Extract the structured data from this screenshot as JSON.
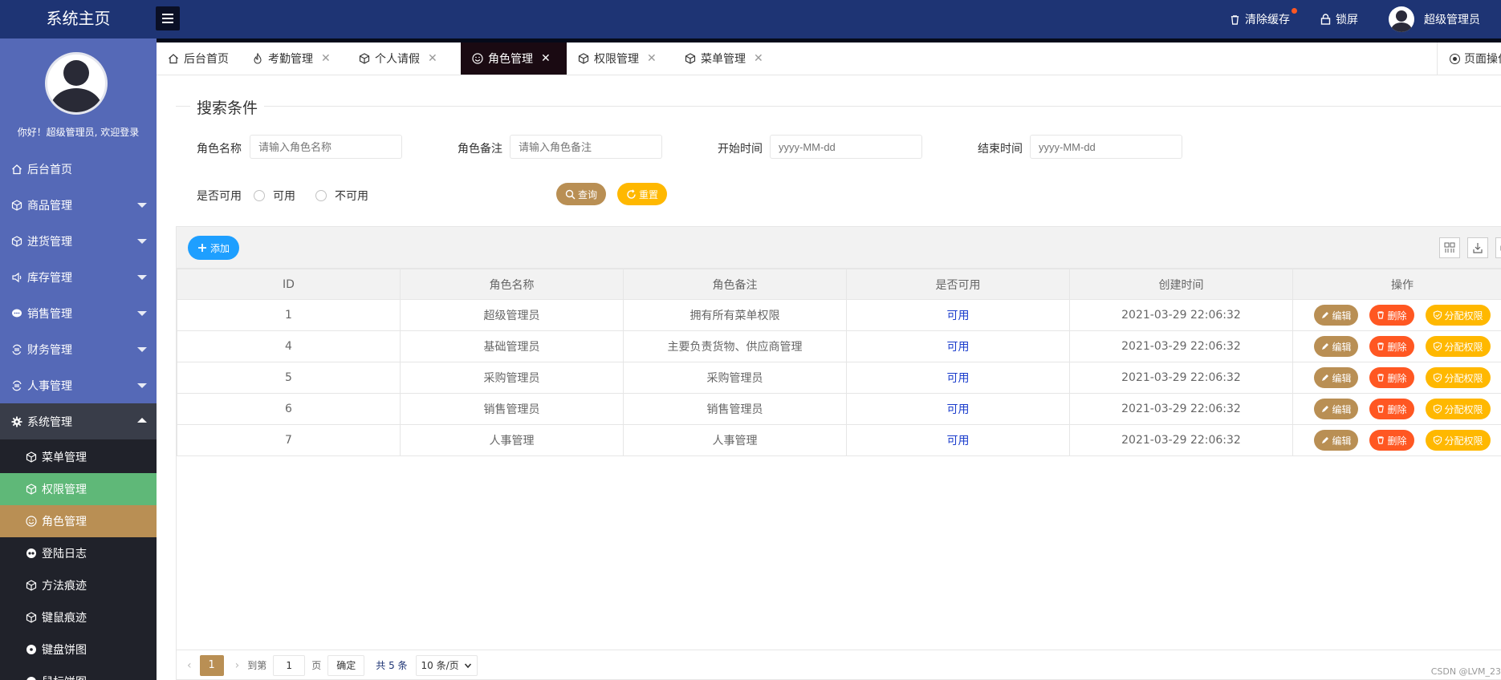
{
  "header": {
    "brand": "系统主页",
    "clear_cache": "清除缓存",
    "lock_screen": "锁屏",
    "username": "超级管理员"
  },
  "sidebar": {
    "welcome": "你好！超级管理员, 欢迎登录",
    "items": [
      {
        "label": "后台首页",
        "icon": "home-icon"
      },
      {
        "label": "商品管理",
        "icon": "cube-icon"
      },
      {
        "label": "进货管理",
        "icon": "cube-icon"
      },
      {
        "label": "库存管理",
        "icon": "speaker-icon"
      },
      {
        "label": "销售管理",
        "icon": "chat-icon"
      },
      {
        "label": "财务管理",
        "icon": "exchange-icon"
      },
      {
        "label": "人事管理",
        "icon": "exchange-icon"
      },
      {
        "label": "系统管理",
        "icon": "gear-icon"
      }
    ],
    "sub_items": [
      {
        "label": "菜单管理",
        "icon": "cube-icon"
      },
      {
        "label": "权限管理",
        "icon": "cube-icon"
      },
      {
        "label": "角色管理",
        "icon": "smile-icon"
      },
      {
        "label": "登陆日志",
        "icon": "eye-icon"
      },
      {
        "label": "方法痕迹",
        "icon": "cube-icon"
      },
      {
        "label": "键鼠痕迹",
        "icon": "cube-icon"
      },
      {
        "label": "键盘饼图",
        "icon": "disc-icon"
      },
      {
        "label": "鼠标饼图",
        "icon": "disc-icon"
      }
    ]
  },
  "tabs": [
    {
      "label": "后台首页"
    },
    {
      "label": "考勤管理"
    },
    {
      "label": "个人请假"
    },
    {
      "label": "角色管理"
    },
    {
      "label": "权限管理"
    },
    {
      "label": "菜单管理"
    }
  ],
  "tab_close": "✕",
  "page_ops": "页面操作",
  "search": {
    "legend": "搜索条件",
    "role_name_label": "角色名称",
    "role_name_placeholder": "请输入角色名称",
    "role_remark_label": "角色备注",
    "role_remark_placeholder": "请输入角色备注",
    "start_label": "开始时间",
    "start_placeholder": "yyyy-MM-dd",
    "end_label": "结束时间",
    "end_placeholder": "yyyy-MM-dd",
    "available_label": "是否可用",
    "opt_yes": "可用",
    "opt_no": "不可用",
    "query": "查询",
    "reset": "重置"
  },
  "toolbar": {
    "add": "添加"
  },
  "table": {
    "headers": [
      "ID",
      "角色名称",
      "角色备注",
      "是否可用",
      "创建时间",
      "操作"
    ],
    "rows": [
      {
        "id": "1",
        "name": "超级管理员",
        "remark": "拥有所有菜单权限",
        "available": "可用",
        "created": "2021-03-29 22:06:32"
      },
      {
        "id": "4",
        "name": "基础管理员",
        "remark": "主要负责货物、供应商管理",
        "available": "可用",
        "created": "2021-03-29 22:06:32"
      },
      {
        "id": "5",
        "name": "采购管理员",
        "remark": "采购管理员",
        "available": "可用",
        "created": "2021-03-29 22:06:32"
      },
      {
        "id": "6",
        "name": "销售管理员",
        "remark": "销售管理员",
        "available": "可用",
        "created": "2021-03-29 22:06:32"
      },
      {
        "id": "7",
        "name": "人事管理",
        "remark": "人事管理",
        "available": "可用",
        "created": "2021-03-29 22:06:32"
      }
    ],
    "op_edit": "编辑",
    "op_delete": "删除",
    "op_assign": "分配权限"
  },
  "pager": {
    "current": "1",
    "goto": "到第",
    "page_input": "1",
    "page_unit": "页",
    "confirm": "确定",
    "total": "共 5 条",
    "per_page": "10 条/页"
  },
  "watermark": "CSDN @LVM_23"
}
